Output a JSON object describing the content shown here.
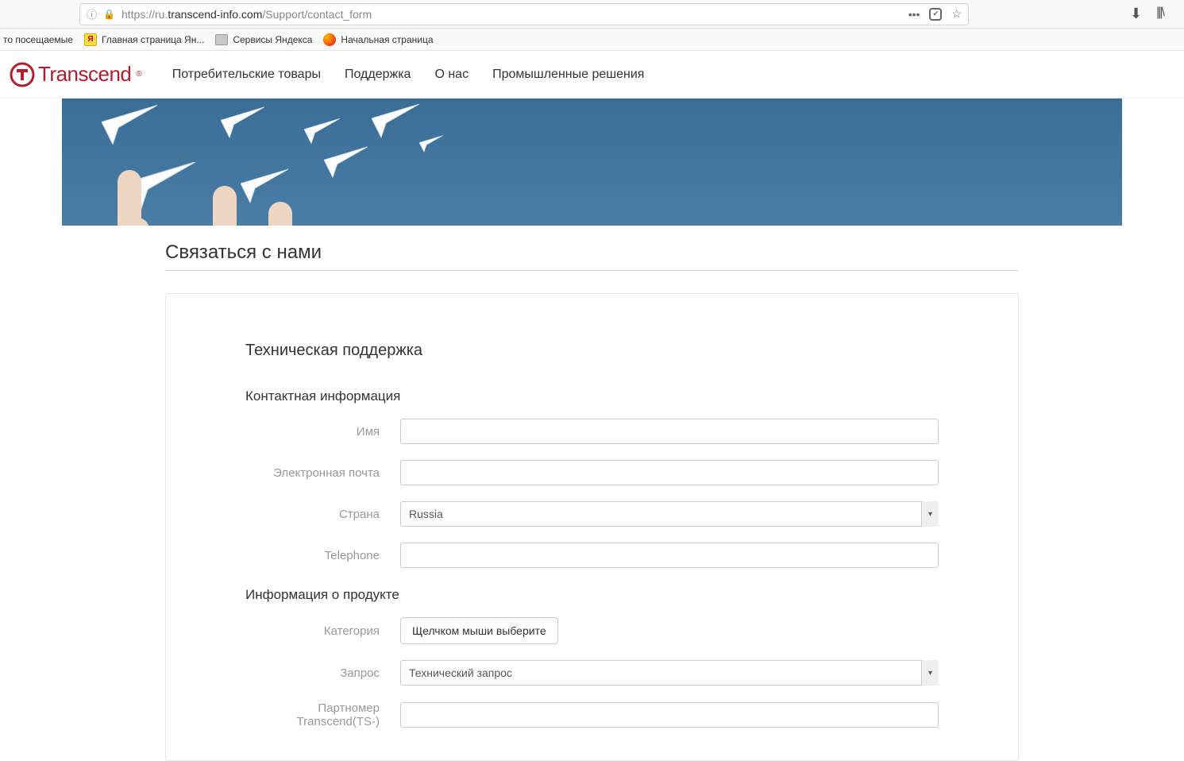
{
  "browser": {
    "url_prefix": "https://ru.",
    "url_host": "transcend-info.com",
    "url_path": "/Support/contact_form"
  },
  "bookmarks": {
    "most_visited": "то посещаемые",
    "ya_main": "Главная страница Ян...",
    "ya_services": "Сервисы Яндекса",
    "start_page": "Начальная страница"
  },
  "brand": {
    "logo_text": "Transcend",
    "logo_reg": "®"
  },
  "nav": {
    "consumer": "Потребительские товары",
    "support": "Поддержка",
    "about": "О нас",
    "industrial": "Промышленные решения"
  },
  "page": {
    "title": "Связаться с нами",
    "form_heading": "Техническая поддержка",
    "contact_heading": "Контактная информация",
    "product_heading": "Информация о продукте"
  },
  "fields": {
    "name_label": "Имя",
    "email_label": "Электронная почта",
    "country_label": "Страна",
    "country_value": "Russia",
    "telephone_label": "Telephone",
    "category_label": "Категория",
    "category_btn": "Щелчком мыши выберите",
    "inquiry_label": "Запрос",
    "inquiry_value": "Технический запрос",
    "partnumber_label": "Партномер Transcend(TS-)"
  }
}
